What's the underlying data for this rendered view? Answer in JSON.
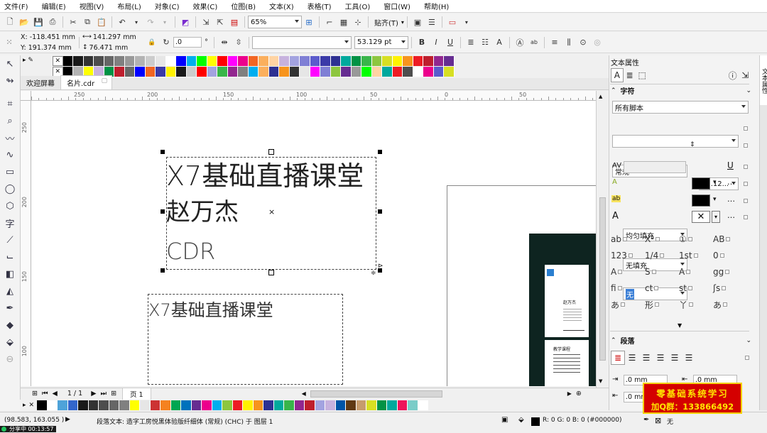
{
  "menu": [
    "文件(F)",
    "编辑(E)",
    "视图(V)",
    "布局(L)",
    "对象(C)",
    "效果(C)",
    "位图(B)",
    "文本(X)",
    "表格(T)",
    "工具(O)",
    "窗口(W)",
    "帮助(H)"
  ],
  "toolbar": {
    "zoom": "65%",
    "snap": "贴齐(T)"
  },
  "propbar": {
    "x": "X: -118.451 mm",
    "y": "Y: 191.374 mm",
    "w": "141.297 mm",
    "h": "76.471 mm",
    "angle": ".0",
    "angle_unit": "°",
    "font_size": "53.129 pt",
    "font_name": ""
  },
  "tabs": {
    "welcome": "欢迎屏幕",
    "doc": "名片.cdr"
  },
  "ruler_h": [
    "250",
    "200",
    "150",
    "100",
    "50",
    "0",
    "50"
  ],
  "ruler_v": [
    "250",
    "200",
    "150",
    "100"
  ],
  "canvas": {
    "line1": "X7基础直播课堂",
    "line2": "赵万杰",
    "line3": "CDR",
    "line4": "X7基础直播课堂"
  },
  "thumb": {
    "name": "赵万杰",
    "section": "教学课程"
  },
  "page_nav": {
    "count": "1 / 1",
    "page_tab": "页 1"
  },
  "docker": {
    "title": "文本属性",
    "char_section": "字符",
    "script": "所有脚本",
    "font_name": "",
    "style": "常规",
    "size": "53.12...",
    "fill": "均匀填充",
    "bgfill": "无填充",
    "outline": "无",
    "para_section": "段落",
    "indent1": ".0 mm",
    "indent2": ".0 mm",
    "indent3": ".0 mm",
    "side_tab": "文本属性"
  },
  "glyphs": [
    "ab",
    "X²",
    "①",
    "AB",
    "123",
    "1/4",
    "1st",
    "0",
    "A",
    "S",
    "A",
    "gg",
    "fi",
    "ct",
    "st",
    "ʃs",
    "あ",
    "形",
    "丫",
    "あ"
  ],
  "status": {
    "coords": "(98.583, 163.055 )",
    "info": "段落文本: 造字工房悦黑体验版纤细体 (常规) (CHC) 于 图层 1",
    "color": "R: 0 G: 0 B: 0 (#000000)",
    "outline": "无",
    "timer": "分享中 00:13:57"
  },
  "promo": {
    "line1": "零基础系统学习",
    "line2": "加Q群：133866492"
  },
  "palette_top": [
    "#000000",
    "#1a1a1a",
    "#333333",
    "#4d4d4d",
    "#666666",
    "#808080",
    "#999999",
    "#b3b3b3",
    "#cccccc",
    "#e6e6e6",
    "#ffffff",
    "#0000ff",
    "#00aeef",
    "#00ff00",
    "#ffff00",
    "#ff0000",
    "#ff00ff",
    "#ec008c",
    "#f26522",
    "#fbaf5d",
    "#ffd4a3",
    "#c7b2de",
    "#a3a3e0",
    "#7f7fd5",
    "#5b5bcc",
    "#3a3aa8",
    "#2e3192",
    "#00a99d",
    "#009245",
    "#39b54a",
    "#8dc63f",
    "#d7df23",
    "#fff200",
    "#f7941d",
    "#ed1c24",
    "#be1e2d",
    "#92278f",
    "#662d91"
  ],
  "palette_bottom": [
    "#000000",
    "#ffffff",
    "#4ea3d9",
    "#3366cc",
    "#1a1a1a",
    "#333333",
    "#4d4d4d",
    "#666666",
    "#808080",
    "#ffff00",
    "#e6e6e6",
    "#cc3333",
    "#f58220",
    "#00a651",
    "#0072bc",
    "#662d91",
    "#ec008c",
    "#00aeef",
    "#8dc63f",
    "#ed1c24",
    "#fff200",
    "#f7941d",
    "#2e3192",
    "#00a99d",
    "#39b54a",
    "#92278f",
    "#be1e2d",
    "#a3a3e0",
    "#c7b2de",
    "#0054a6",
    "#603913",
    "#c69c6d",
    "#d7df23",
    "#009245",
    "#00a99d",
    "#ed145b",
    "#7accc8",
    "#ffffff"
  ]
}
